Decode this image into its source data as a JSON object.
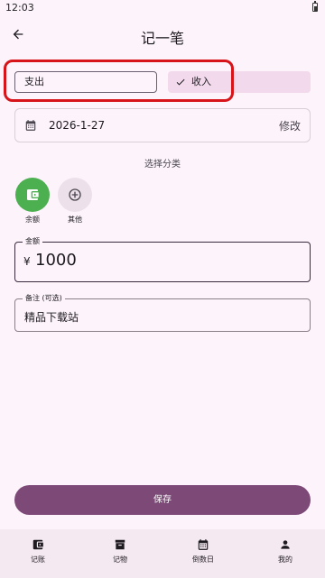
{
  "status": {
    "time": "12:03"
  },
  "header": {
    "title": "记一笔"
  },
  "type_toggle": {
    "expense_label": "支出",
    "income_label": "收入",
    "selected": "income"
  },
  "date": {
    "value": "2026-1-27",
    "edit_label": "修改"
  },
  "category": {
    "section_label": "选择分类",
    "items": [
      {
        "label": "余额",
        "icon": "wallet-icon",
        "color": "#4caf50"
      },
      {
        "label": "其他",
        "icon": "add-circle-icon",
        "color": "#ece1ea"
      }
    ]
  },
  "amount": {
    "legend": "金额",
    "currency": "¥",
    "value": "1000"
  },
  "note": {
    "legend": "备注 (可选)",
    "value": "精品下载站"
  },
  "save_label": "保存",
  "nav": {
    "items": [
      {
        "label": "记账",
        "icon": "wallet-icon"
      },
      {
        "label": "记物",
        "icon": "archive-icon"
      },
      {
        "label": "倒数日",
        "icon": "calendar-icon"
      },
      {
        "label": "我的",
        "icon": "person-icon"
      }
    ]
  },
  "colors": {
    "accent": "#7d4a78",
    "annotation": "#d8141b",
    "background": "#fdf3fb"
  }
}
